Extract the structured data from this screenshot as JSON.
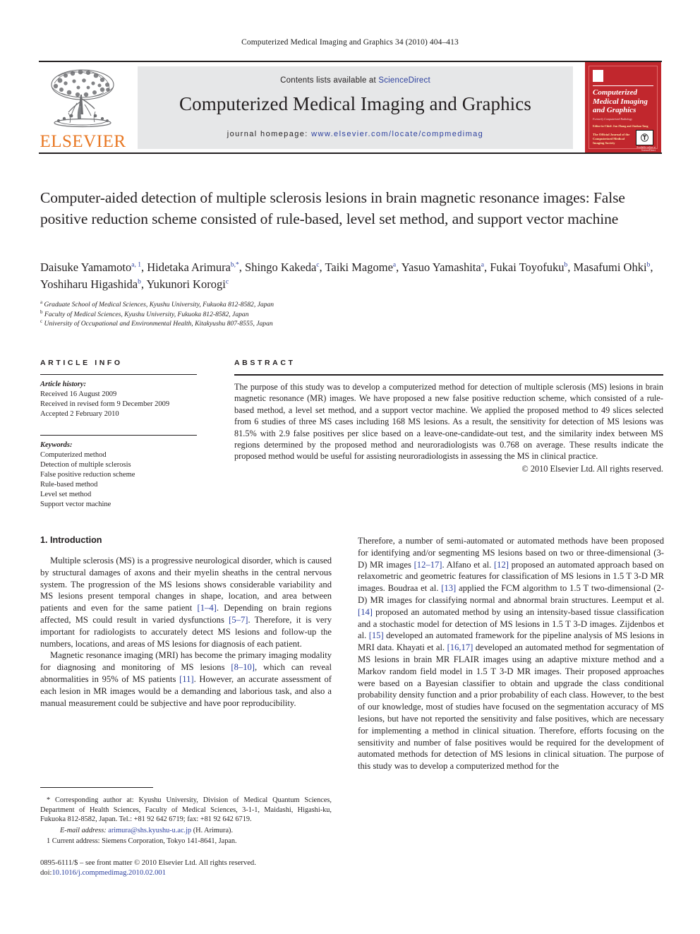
{
  "running_head": "Computerized Medical Imaging and Graphics 34 (2010) 404–413",
  "masthead": {
    "contents_prefix": "Contents lists available at ",
    "sciencedirect": "ScienceDirect",
    "journal_title": "Computerized Medical Imaging and Graphics",
    "homepage_prefix": "journal homepage: ",
    "homepage_url": "www.elsevier.com/locate/compmedimag",
    "publisher_wordmark": "ELSEVIER"
  },
  "cover": {
    "title": "Computerized Medical Imaging and Graphics",
    "subtitle": "Formerly Computerized Radiology",
    "editors": "Editor-in-Chief: Jun Zhang and Jinshan Tang",
    "official_line": "The Official Journal of the Computerized Medical Imaging Society",
    "badge_glyph": "Ⓣ",
    "foot": "Available online at ScienceDirect"
  },
  "title": "Computer-aided detection of multiple sclerosis lesions in brain magnetic resonance images: False positive reduction scheme consisted of rule-based, level set method, and support vector machine",
  "authors": [
    {
      "name": "Daisuke Yamamoto",
      "sup": "a, 1",
      "sep": ", "
    },
    {
      "name": "Hidetaka Arimura",
      "sup": "b,*",
      "sep": ", "
    },
    {
      "name": "Shingo Kakeda",
      "sup": "c",
      "sep": ", "
    },
    {
      "name": "Taiki Magome",
      "sup": "a",
      "sep": ", "
    },
    {
      "name": "Yasuo Yamashita",
      "sup": "a",
      "sep": ", "
    },
    {
      "name": "Fukai Toyofuku",
      "sup": "b",
      "sep": ", "
    },
    {
      "name": "Masafumi Ohki",
      "sup": "b",
      "sep": ", "
    },
    {
      "name": "Yoshiharu Higashida",
      "sup": "b",
      "sep": ", "
    },
    {
      "name": "Yukunori Korogi",
      "sup": "c",
      "sep": ""
    }
  ],
  "affiliations": [
    {
      "mark": "a",
      "text": "Graduate School of Medical Sciences, Kyushu University, Fukuoka 812-8582, Japan"
    },
    {
      "mark": "b",
      "text": "Faculty of Medical Sciences, Kyushu University, Fukuoka 812-8582, Japan"
    },
    {
      "mark": "c",
      "text": "University of Occupational and Environmental Health, Kitakyushu 807-8555, Japan"
    }
  ],
  "article_info": {
    "heading": "ARTICLE INFO",
    "history_label": "Article history:",
    "history": [
      "Received 16 August 2009",
      "Received in revised form 9 December 2009",
      "Accepted 2 February 2010"
    ],
    "keywords_label": "Keywords:",
    "keywords": [
      "Computerized method",
      "Detection of multiple sclerosis",
      "False positive reduction scheme",
      "Rule-based method",
      "Level set method",
      "Support vector machine"
    ]
  },
  "abstract": {
    "heading": "ABSTRACT",
    "body": "The purpose of this study was to develop a computerized method for detection of multiple sclerosis (MS) lesions in brain magnetic resonance (MR) images. We have proposed a new false positive reduction scheme, which consisted of a rule-based method, a level set method, and a support vector machine. We applied the proposed method to 49 slices selected from 6 studies of three MS cases including 168 MS lesions. As a result, the sensitivity for detection of MS lesions was 81.5% with 2.9 false positives per slice based on a leave-one-candidate-out test, and the similarity index between MS regions determined by the proposed method and neuroradiologists was 0.768 on average. These results indicate the proposed method would be useful for assisting neuroradiologists in assessing the MS in clinical practice.",
    "copyright": "© 2010 Elsevier Ltd. All rights reserved."
  },
  "body": {
    "section_title": "1. Introduction",
    "left_paragraphs": [
      "Multiple sclerosis (MS) is a progressive neurological disorder, which is caused by structural damages of axons and their myelin sheaths in the central nervous system. The progression of the MS lesions shows considerable variability and MS lesions present temporal changes in shape, location, and area between patients and even for the same patient [1–4]. Depending on brain regions affected, MS could result in varied dysfunctions [5–7]. Therefore, it is very important for radiologists to accurately detect MS lesions and follow-up the numbers, locations, and areas of MS lesions for diagnosis of each patient.",
      "Magnetic resonance imaging (MRI) has become the primary imaging modality for diagnosing and monitoring of MS lesions [8–10], which can reveal abnormalities in 95% of MS patients [11]. However, an accurate assessment of each lesion in MR images would be a demanding and laborious task, and also a manual measurement could be subjective and have poor reproducibility."
    ],
    "right_paragraphs": [
      "Therefore, a number of semi-automated or automated methods have been proposed for identifying and/or segmenting MS lesions based on two or three-dimensional (3-D) MR images [12–17]. Alfano et al. [12] proposed an automated approach based on relaxometric and geometric features for classification of MS lesions in 1.5 T 3-D MR images. Boudraa et al. [13] applied the FCM algorithm to 1.5 T two-dimensional (2-D) MR images for classifying normal and abnormal brain structures. Leemput et al. [14] proposed an automated method by using an intensity-based tissue classification and a stochastic model for detection of MS lesions in 1.5 T 3-D images. Zijdenbos et al. [15] developed an automated framework for the pipeline analysis of MS lesions in MRI data. Khayati et al. [16,17] developed an automated method for segmentation of MS lesions in brain MR FLAIR images using an adaptive mixture method and a Markov random field model in 1.5 T 3-D MR images. Their proposed approaches were based on a Bayesian classifier to obtain and upgrade the class conditional probability density function and a prior probability of each class. However, to the best of our knowledge, most of studies have focused on the segmentation accuracy of MS lesions, but have not reported the sensitivity and false positives, which are necessary for implementing a method in clinical situation. Therefore, efforts focusing on the sensitivity and number of false positives would be required for the development of automated methods for detection of MS lesions in clinical situation. The purpose of this study was to develop a computerized method for the"
    ]
  },
  "footnotes": {
    "corresponding": "* Corresponding author at: Kyushu University, Division of Medical Quantum Sciences, Department of Health Sciences, Faculty of Medical Sciences, 3-1-1, Maidashi, Higashi-ku, Fukuoka 812-8582, Japan. Tel.: +81 92 642 6719; fax: +81 92 642 6719.",
    "email_label": "E-mail address:",
    "email": "arimura@shs.kyushu-u.ac.jp",
    "email_suffix": "(H. Arimura).",
    "current_address": "1 Current address: Siemens Corporation, Tokyo 141-8641, Japan."
  },
  "imprint": {
    "front_matter": "0895-6111/$ – see front matter © 2010 Elsevier Ltd. All rights reserved.",
    "doi_label": "doi:",
    "doi": "10.1016/j.compmedimag.2010.02.001"
  },
  "colors": {
    "link_blue": "#2b3f9e",
    "elsevier_orange": "#e87722",
    "masthead_gray": "#e6e7e8",
    "cover_red": "#c1272d",
    "text": "#231f20"
  }
}
